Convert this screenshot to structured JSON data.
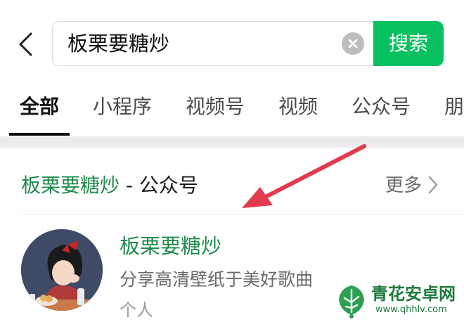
{
  "search": {
    "value": "板栗要糖炒",
    "button_label": "搜索"
  },
  "tabs": [
    {
      "label": "全部",
      "active": true
    },
    {
      "label": "小程序"
    },
    {
      "label": "视频号"
    },
    {
      "label": "视频"
    },
    {
      "label": "公众号"
    },
    {
      "label": "朋"
    }
  ],
  "section": {
    "title_keyword": "板栗要糖炒",
    "title_suffix": " - 公众号",
    "more_label": "更多"
  },
  "result": {
    "name": "板栗要糖炒",
    "description": "分享高清壁纸于美好歌曲",
    "type": "个人"
  },
  "watermark": {
    "name": "青花安卓网",
    "url": "www.qhhlv.com"
  },
  "colors": {
    "accent_green": "#07c160",
    "link_green": "#1f8a4c",
    "annotation_red": "#e23a4e"
  },
  "icons": [
    "back-chevron-icon",
    "clear-icon",
    "chevron-right-icon",
    "annotation-arrow-icon"
  ]
}
